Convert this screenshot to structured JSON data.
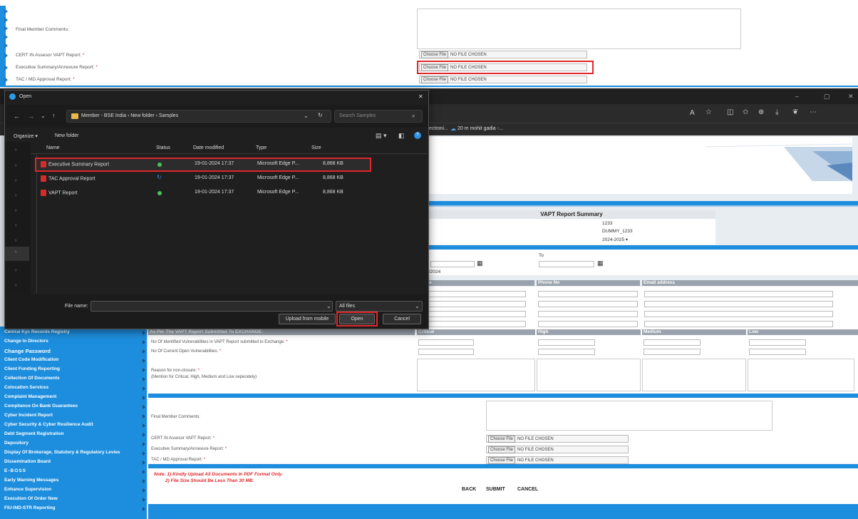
{
  "top_form": {
    "final_comments_label": "Final Member Comments:",
    "cert_label": "CERT IN Assesor VAPT Report:",
    "exec_label": "Executive Summary/Annexure Report:",
    "tac_label": "TAC / MD Approval Report:",
    "required_mark": "*",
    "choose_file": "Choose File",
    "no_file": "NO FILE CHOSEN"
  },
  "browser": {
    "bookmark_1": "ectroni...",
    "bookmark_2": "20 m mohit gadia -...",
    "minimize": "–",
    "maximize": "▢",
    "close": "✕"
  },
  "page": {
    "summary_title": "VAPT Report Summary",
    "member_code": "1233",
    "member_name": "DUMMY_1233",
    "year_value": "2024-2025",
    "to_label": "To",
    "date_partial": "/2024",
    "col_e": "e",
    "col_phone": "Phone No",
    "col_email": "Email address",
    "as_per_header": "As Per The VAPT Report Submitted To EXCHANGE:",
    "col_critical": "Critical",
    "col_high": "High",
    "col_medium": "Medium",
    "col_low": "Low",
    "no_identified": "No Of Identified Vulnerabilities in VAPT Report submitted to Exchange:",
    "no_current": "No Of Current Open Vulnerabilities:",
    "reason_label": "Reason for non-closure:",
    "reason_sub": "(Mention for Critical, High, Medium and Low seperately)",
    "final_comments_label": "Final Member Comments:",
    "cert_label": "CERT IN Assesor VAPT Report:",
    "exec_label": "Executive Summary/Annexure Report:",
    "tac_label": "TAC / MD Approval Report:",
    "note_1": "Note: 1) Kindly Upload All Documents In PDF Format Only.",
    "note_2": "2) File Size Should Be Less Than 30 MB.",
    "back": "BACK",
    "submit": "SUBMIT",
    "cancel": "CANCEL"
  },
  "sidebar": {
    "items": [
      "Central Kyc Records Registry",
      "Change In Directors",
      "Change Password",
      "Client Code Modification",
      "Client Funding Reporting",
      "Collection Of Documents",
      "Colocation Services",
      "Complaint Management",
      "Compliance On Bank Guarantees",
      "Cyber Incident Report",
      "Cyber Security & Cyber Resilience Audit",
      "Debt Segment Registration",
      "Depository",
      "Display Of Brokerage, Statutory & Regulatory Levies",
      "Dissemination Board",
      "E-BOSS",
      "Early Warning Messages",
      "Enhance Supervision",
      "Execution Of Order New",
      "FIU-IND-STR Reporting"
    ]
  },
  "dialog": {
    "title": "Open",
    "close": "✕",
    "breadcrumb": "Member - BSE India  ›  New folder  ›  Samples",
    "search_placeholder": "Search Samples",
    "organize": "Organize ▾",
    "new_folder": "New folder",
    "col_name": "Name",
    "col_status": "Status",
    "col_date": "Date modified",
    "col_type": "Type",
    "col_size": "Size",
    "files": [
      {
        "name": "Executive Summary Report",
        "date": "19-01-2024 17:37",
        "type": "Microsoft Edge P...",
        "size": "8,868 KB",
        "status": "synced"
      },
      {
        "name": "TAC Approval Report",
        "date": "19-01-2024 17:37",
        "type": "Microsoft Edge P...",
        "size": "8,868 KB",
        "status": "syncing"
      },
      {
        "name": "VAPT Report",
        "date": "19-01-2024 17:37",
        "type": "Microsoft Edge P...",
        "size": "8,868 KB",
        "status": "synced"
      }
    ],
    "file_name_label": "File name:",
    "file_type": "All files",
    "upload_mobile": "Upload from mobile",
    "open": "Open",
    "cancel": "Cancel"
  },
  "colors": {
    "accent": "#1d8ede",
    "highlight": "#e0262a",
    "dialog_bg": "#1f1f1f"
  }
}
